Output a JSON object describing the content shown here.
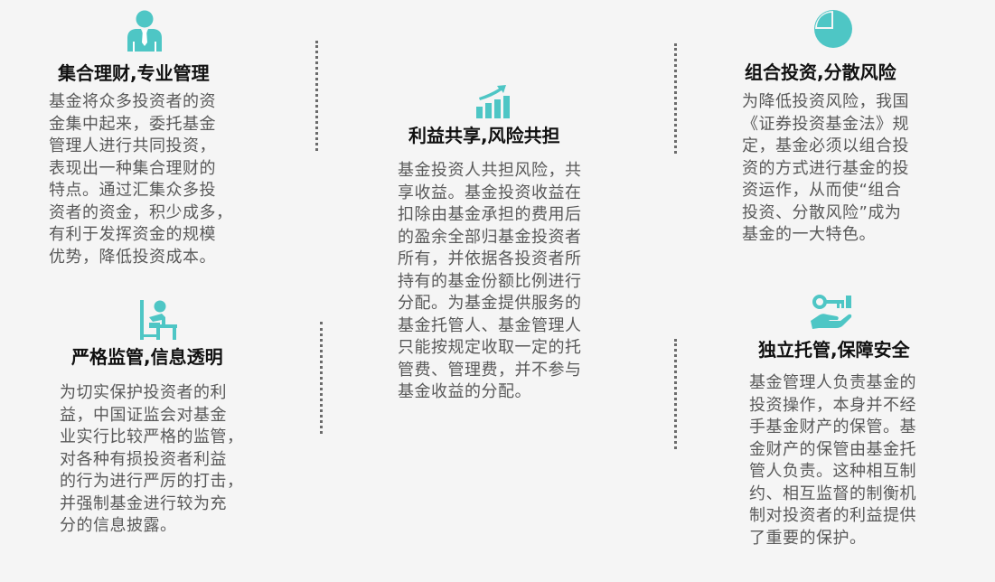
{
  "colors": {
    "accent": "#4ec6c5",
    "title": "#111111",
    "body": "#595959",
    "background": "#f5f5f5"
  },
  "sections": [
    {
      "icon": "businessman-icon",
      "title": "集合理财,专业管理",
      "lines": [
        "基金将众多投资者的资",
        "金集中起来，委托基金",
        "管理人进行共同投资，",
        "表现出一种集合理财的",
        "特点。通过汇集众多投",
        "资者的资金，积少成多，",
        "有利于发挥资金的规模",
        "优势，降低投资成本。"
      ]
    },
    {
      "icon": "growth-chart-icon",
      "title": "利益共享,风险共担",
      "lines": [
        "基金投资人共担风险，共",
        "享收益。基金投资收益在",
        "扣除由基金承担的费用后",
        "的盈余全部归基金投资者",
        "所有，并依据各投资者所",
        "持有的基金份额比例进行",
        "分配。为基金提供服务的",
        "基金托管人、基金管理人",
        "只能按规定收取一定的托",
        "管费、管理费，并不参与",
        "基金收益的分配。"
      ]
    },
    {
      "icon": "pie-chart-icon",
      "title": "组合投资,分散风险",
      "lines": [
        "为降低投资风险，我国",
        "《证券投资基金法》规",
        "定，基金必须以组合投",
        "资的方式进行基金的投",
        "资运作，从而使“组合",
        "投资、分散风险”成为",
        "基金的一大特色。"
      ]
    },
    {
      "icon": "desk-worker-icon",
      "title": "严格监管,信息透明",
      "lines": [
        "为切实保护投资者的利",
        "益，中国证监会对基金",
        "业实行比较严格的监管，",
        "对各种有损投资者利益",
        "的行为进行严厉的打击，",
        "并强制基金进行较为充",
        "分的信息披露。"
      ]
    },
    {
      "icon": "hand-key-icon",
      "title": "独立托管,保障安全",
      "lines": [
        "基金管理人负责基金的",
        "投资操作，本身并不经",
        "手基金财产的保管。基",
        "金财产的保管由基金托",
        "管人负责。这种相互制",
        "约、相互监督的制衡机",
        "制对投资者的利益提供",
        "了重要的保护。"
      ]
    }
  ]
}
